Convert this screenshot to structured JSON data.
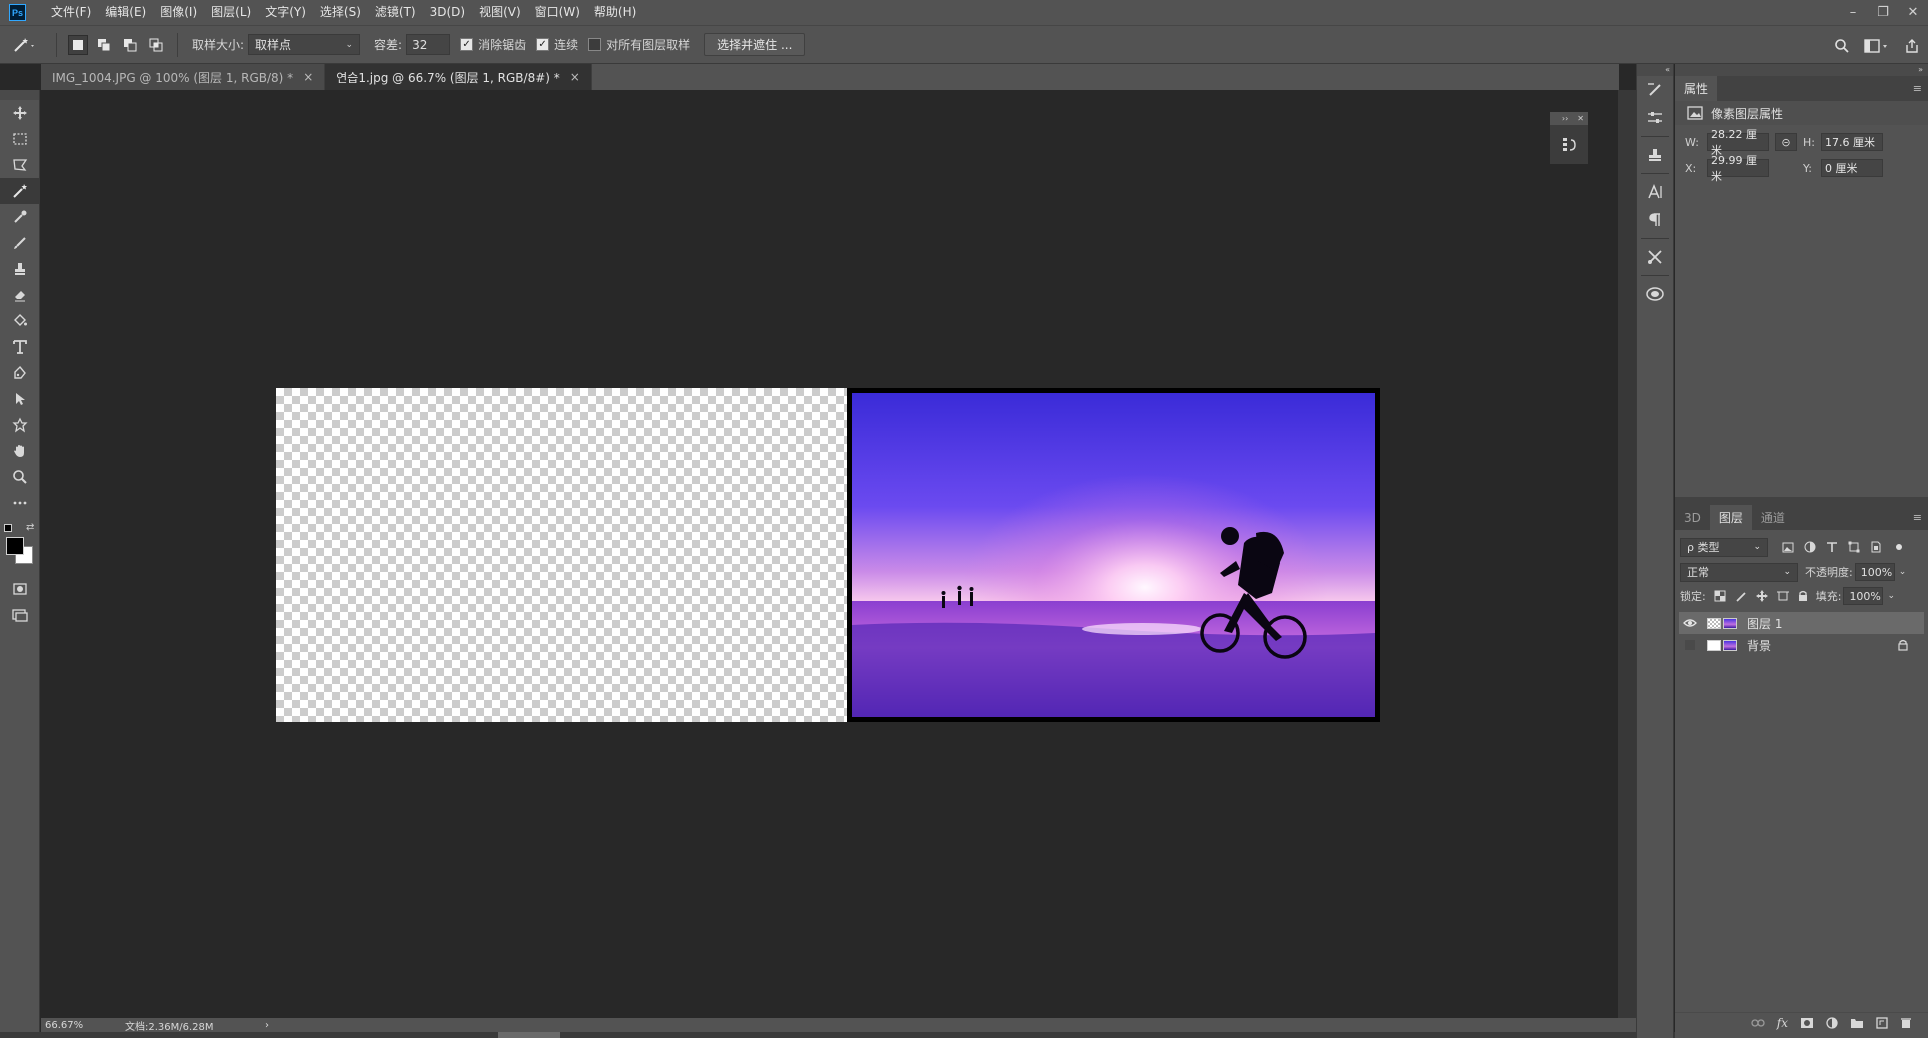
{
  "app": {
    "logo": "Ps"
  },
  "menu": [
    "文件(F)",
    "编辑(E)",
    "图像(I)",
    "图层(L)",
    "文字(Y)",
    "选择(S)",
    "滤镜(T)",
    "3D(D)",
    "视图(V)",
    "窗口(W)",
    "帮助(H)"
  ],
  "window_controls": {
    "minimize": "–",
    "restore": "❐",
    "close": "✕"
  },
  "options": {
    "sample_size_label": "取样大小:",
    "sample_size_value": "取样点",
    "tolerance_label": "容差:",
    "tolerance_value": "32",
    "antialias_label": "消除锯齿",
    "antialias_checked": true,
    "contiguous_label": "连续",
    "contiguous_checked": true,
    "sample_all_label": "对所有图层取样",
    "sample_all_checked": false,
    "select_mask_button": "选择并遮住 ..."
  },
  "tabs": [
    {
      "label": "IMG_1004.JPG @ 100% (图层 1, RGB/8) *",
      "close": "×",
      "active": false
    },
    {
      "label": "연습1.jpg @ 66.7% (图层 1, RGB/8#) *",
      "close": "×",
      "active": true
    }
  ],
  "status": {
    "zoom": "66.67%",
    "doc": "文档:2.36M/6.28M",
    "arrow": "›"
  },
  "properties": {
    "tab": "属性",
    "section": "像素图层属性",
    "w_label": "W:",
    "w_value": "28.22 厘米",
    "h_label": "H:",
    "h_value": "17.6 厘米",
    "x_label": "X:",
    "x_value": "29.99 厘米",
    "y_label": "Y:",
    "y_value": "0 厘米"
  },
  "layers_panel": {
    "tabs": [
      "3D",
      "图层",
      "通道"
    ],
    "active_tab": "图层",
    "filter_label": "ρ 类型",
    "blend_mode": "正常",
    "opacity_label": "不透明度:",
    "opacity_value": "100%",
    "lock_label": "锁定:",
    "fill_label": "填充:",
    "fill_value": "100%",
    "layers": [
      {
        "name": "图层 1",
        "visible": true,
        "selected": true,
        "locked": false
      },
      {
        "name": "背景",
        "visible": false,
        "selected": false,
        "locked": true
      }
    ]
  },
  "colors": {
    "accent": "#31a8ff",
    "foreground": "#000000",
    "background": "#ffffff"
  }
}
